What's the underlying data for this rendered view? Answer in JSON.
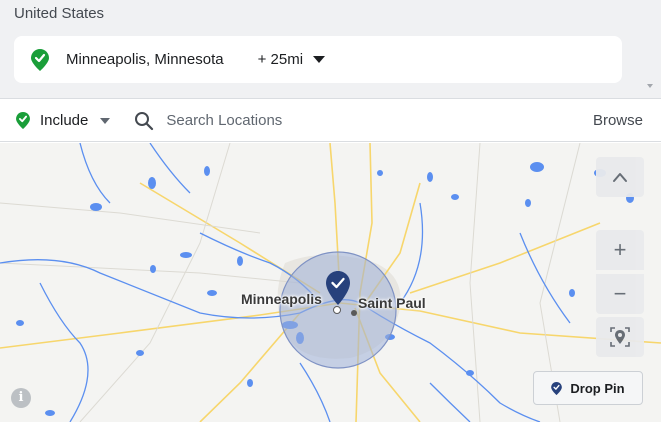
{
  "targeting": {
    "country": "United States",
    "location": {
      "name": "Minneapolis, Minnesota",
      "radius": "+ 25mi"
    }
  },
  "toolbar": {
    "include_label": "Include",
    "search_placeholder": "Search Locations",
    "browse_label": "Browse"
  },
  "map": {
    "labels": {
      "city1": "Minneapolis",
      "city2": "Saint Paul"
    },
    "controls": {
      "zoom_in": "+",
      "zoom_out": "−",
      "info": "i"
    },
    "drop_pin_label": "Drop Pin"
  },
  "colors": {
    "include_green": "#1a9e39",
    "pin_navy": "#27417c",
    "radius_fill": "#9fb0d8",
    "water": "#5b8ff0",
    "highway": "#f7d66c"
  }
}
